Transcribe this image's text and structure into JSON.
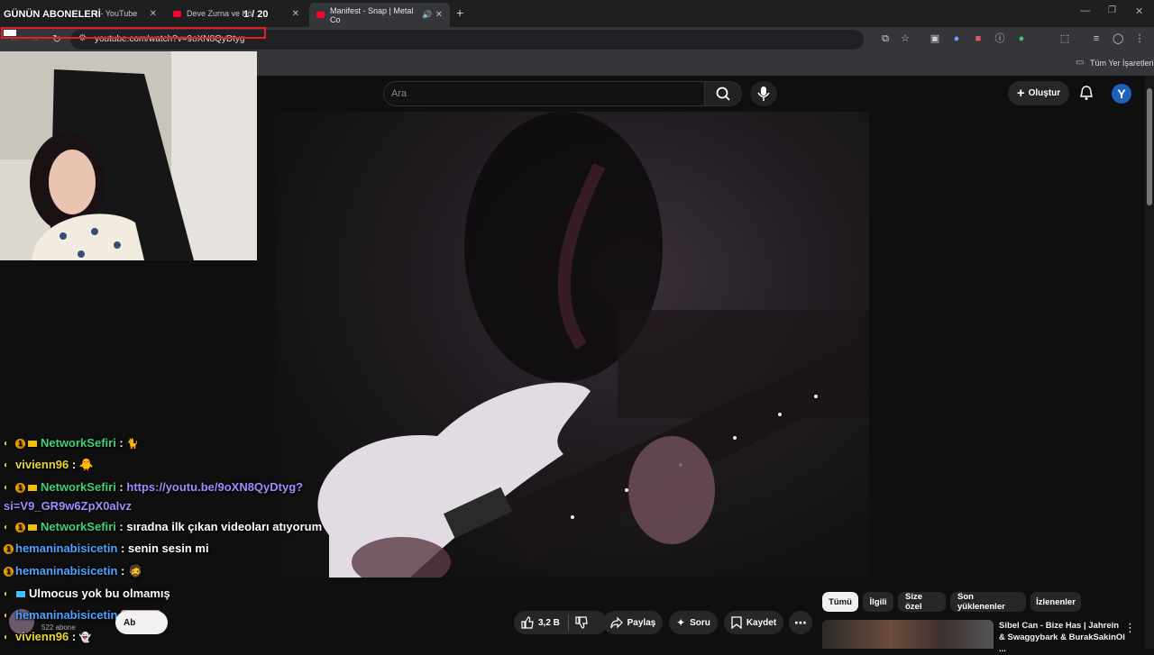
{
  "overlay": {
    "title": "GÜNÜN ABONELERİ",
    "count": "1 / 20"
  },
  "browser": {
    "tabs": [
      {
        "label": "4 - YouTube"
      },
      {
        "label": "Deve Zurna ve Kö"
      },
      {
        "label": "Manifest - Snap | Metal Co"
      }
    ],
    "url": "youtube.com/watch?v=9oXN8QyDtyg",
    "bookmarks_label": "Tüm Yer İşaretleri"
  },
  "youtube": {
    "search_placeholder": "Ara",
    "create_label": "Oluştur",
    "avatar_letter": "Y"
  },
  "chat": [
    {
      "user": "NetworkSefiri",
      "color": "green",
      "text": ""
    },
    {
      "user": "vivienn96",
      "color": "yellow",
      "text": ""
    },
    {
      "user": "NetworkSefiri",
      "color": "green",
      "text": "https://youtu.be/9oXN8QyDtyg?"
    },
    {
      "user": "",
      "color": "link",
      "text": "si=V9_GR9w6ZpX0alvz"
    },
    {
      "user": "NetworkSefiri",
      "color": "green",
      "text": "sıradna ilk çıkan videoları atıyorum"
    },
    {
      "user": "hemaninabisicetin",
      "color": "blue",
      "text": "senin sesin mi"
    },
    {
      "user": "hemaninabisicetin",
      "color": "blue",
      "text": ""
    },
    {
      "user": "",
      "color": "white",
      "text": "Ulmocus yok bu olmamış"
    },
    {
      "user": "hemaninabisicetin",
      "color": "blue",
      "text": ""
    },
    {
      "user": "vivienn96",
      "color": "yellow",
      "text": ""
    }
  ],
  "channel": {
    "subscribers": "522 abone",
    "subscribe_label": "Ab"
  },
  "actions": {
    "like_count": "3,2 B",
    "share_label": "Paylaş",
    "ask_label": "Soru",
    "save_label": "Kaydet"
  },
  "filter_chips": [
    "Tümü",
    "İlgili",
    "Size özel",
    "Son yüklenenler",
    "İzlenenler"
  ],
  "recommendation": {
    "title": "Sibel Can - Bize Has | Jahrein & Swaggybark & BurakSakinOl ..."
  }
}
